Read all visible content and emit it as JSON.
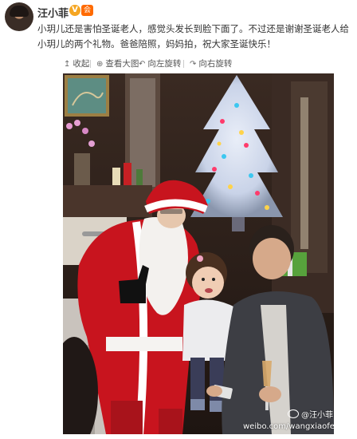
{
  "user": {
    "name": "汪小菲",
    "verified_badge": "V",
    "member_badge": "会"
  },
  "post": {
    "text": "小玥儿还是害怕圣诞老人，感觉头发长到脸下面了。不过还是谢谢圣诞老人给小玥儿的两个礼物。爸爸陪照，妈妈拍，祝大家圣诞快乐！"
  },
  "toolbar": {
    "collapse": {
      "label": "收起",
      "icon": "collapse-icon"
    },
    "view_large": {
      "label": "查看大图",
      "icon": "magnify-icon"
    },
    "rotate_left": {
      "label": "向左旋转",
      "icon": "rotate-left-icon"
    },
    "rotate_right": {
      "label": "向右旋转",
      "icon": "rotate-right-icon"
    }
  },
  "watermark": {
    "handle": "@汪小菲",
    "url": "weibo.com/wangxiaofei"
  },
  "colors": {
    "text": "#333333",
    "link": "#eb7350",
    "verified": "#f5a623",
    "santa_red": "#c8141e"
  }
}
